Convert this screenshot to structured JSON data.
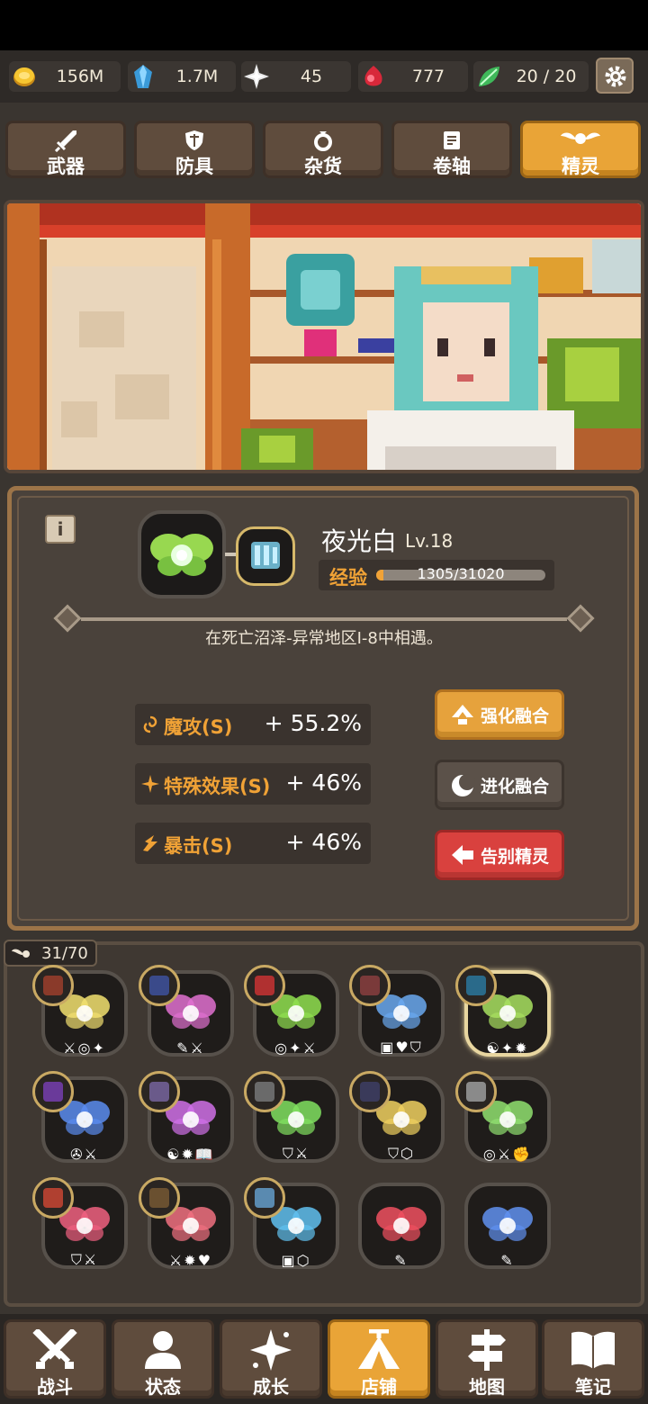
{
  "currencies": [
    {
      "icon": "gold-coin-icon",
      "value": "156M"
    },
    {
      "icon": "blue-crystal-icon",
      "value": "1.7M"
    },
    {
      "icon": "star-dust-icon",
      "value": "45"
    },
    {
      "icon": "red-gem-icon",
      "value": "777"
    },
    {
      "icon": "green-leaf-gem-icon",
      "value": "20 / 20"
    }
  ],
  "shop_tabs": [
    {
      "icon": "sword-icon",
      "label": "武器"
    },
    {
      "icon": "shield-icon",
      "label": "防具"
    },
    {
      "icon": "ring-icon",
      "label": "杂货"
    },
    {
      "icon": "scroll-icon",
      "label": "卷轴"
    },
    {
      "icon": "fairy-icon",
      "label": "精灵"
    }
  ],
  "active_tab": 4,
  "detail": {
    "info_label": "i",
    "name": "夜光白",
    "level": "Lv.18",
    "exp_label": "经验",
    "exp_text": "1305/31020",
    "exp_progress": 0.042,
    "encounter": "在死亡沼泽-异常地区I-8中相遇。",
    "stats": [
      {
        "icon": "magic-swirl-icon",
        "name": "魔攻(S)",
        "value": "+ 55.2%"
      },
      {
        "icon": "sparkle-icon",
        "name": "特殊效果(S)",
        "value": "+ 46%"
      },
      {
        "icon": "crit-burst-icon",
        "name": "暴击(S)",
        "value": "+ 46%"
      }
    ],
    "actions": [
      {
        "icon": "arrow-up-icon",
        "label": "强化融合",
        "style": "orange"
      },
      {
        "icon": "moon-icon",
        "label": "进化融合",
        "style": "gray"
      },
      {
        "icon": "arrow-left-icon",
        "label": "告别精灵",
        "style": "red"
      }
    ]
  },
  "collection": {
    "count": "31/70",
    "slots": [
      {
        "color": "#f2e070",
        "equip": "#8a3a2a",
        "stats": "⚔◎✦",
        "selected": false
      },
      {
        "color": "#e070d0",
        "equip": "#3a4a8a",
        "stats": "✎⚔",
        "selected": false
      },
      {
        "color": "#90e050",
        "equip": "#b03030",
        "stats": "◎✦⚔",
        "selected": false
      },
      {
        "color": "#6aa8f0",
        "equip": "#7a3a3a",
        "stats": "▣♥⛉",
        "selected": false
      },
      {
        "color": "#a8e060",
        "equip": "#2a6a8a",
        "stats": "☯✦✹",
        "selected": true
      },
      {
        "color": "#5a8cf0",
        "equip": "#6a3a9a",
        "stats": "✇⚔",
        "selected": false
      },
      {
        "color": "#d070e8",
        "equip": "#6a5a8a",
        "stats": "☯✹📖",
        "selected": false
      },
      {
        "color": "#80e060",
        "equip": "#6a6a6a",
        "stats": "⛉⚔",
        "selected": false
      },
      {
        "color": "#f0d060",
        "equip": "#3a3a5a",
        "stats": "⛉⬡",
        "selected": false
      },
      {
        "color": "#90e070",
        "equip": "#8a8a8a",
        "stats": "◎⚔✊",
        "selected": false
      },
      {
        "color": "#f06080",
        "equip": "#b04030",
        "stats": "⛉⚔",
        "selected": false
      },
      {
        "color": "#f07080",
        "equip": "#6a5030",
        "stats": "⚔✹♥",
        "selected": false
      },
      {
        "color": "#60c0f0",
        "equip": "#5a8ab0",
        "stats": "▣⬡",
        "selected": false
      },
      {
        "color": "#f05060",
        "equip": "",
        "stats": "✎",
        "selected": false
      },
      {
        "color": "#6090f0",
        "equip": "",
        "stats": "✎",
        "selected": false
      }
    ]
  },
  "nav": [
    {
      "icon": "crossed-swords-icon",
      "label": "战斗"
    },
    {
      "icon": "person-icon",
      "label": "状态"
    },
    {
      "icon": "growth-star-icon",
      "label": "成长"
    },
    {
      "icon": "tent-shop-icon",
      "label": "店铺"
    },
    {
      "icon": "signpost-icon",
      "label": "地图"
    },
    {
      "icon": "book-icon",
      "label": "笔记"
    }
  ],
  "active_nav": 3,
  "colors": {
    "accent": "#e9a437",
    "panel": "#4a423b",
    "exp": "#f0a236"
  }
}
